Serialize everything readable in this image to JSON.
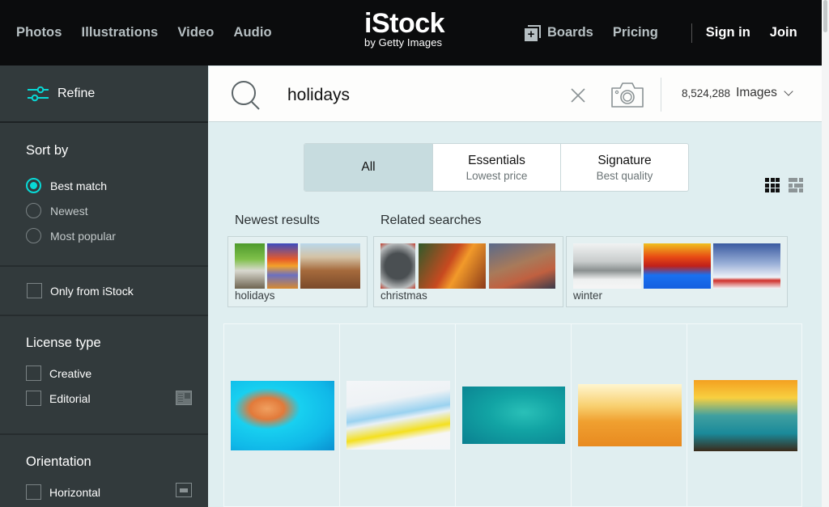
{
  "header": {
    "nav_left": [
      "Photos",
      "Illustrations",
      "Video",
      "Audio"
    ],
    "logo": {
      "main": "iStock",
      "sub": "by Getty Images"
    },
    "boards_label": "Boards",
    "pricing_label": "Pricing",
    "signin_label": "Sign in",
    "join_label": "Join"
  },
  "sidebar": {
    "refine_label": "Refine",
    "sort": {
      "heading": "Sort by",
      "options": [
        {
          "label": "Best match",
          "checked": true
        },
        {
          "label": "Newest",
          "checked": false
        },
        {
          "label": "Most popular",
          "checked": false
        }
      ]
    },
    "only_istock_label": "Only from iStock",
    "license": {
      "heading": "License type",
      "options": [
        "Creative",
        "Editorial"
      ]
    },
    "orientation": {
      "heading": "Orientation",
      "options": [
        "Horizontal"
      ]
    }
  },
  "search": {
    "query": "holidays",
    "result_count": "8,524,288",
    "media_type": "Images"
  },
  "filter_tabs": [
    {
      "title": "All",
      "sub": "",
      "active": true
    },
    {
      "title": "Essentials",
      "sub": "Lowest price",
      "active": false
    },
    {
      "title": "Signature",
      "sub": "Best quality",
      "active": false
    }
  ],
  "sections": {
    "newest": "Newest results",
    "related": "Related searches"
  },
  "cards": [
    {
      "label": "holidays",
      "thumbs": [
        "waterfall",
        "sunset-sky",
        "rooftops"
      ]
    },
    {
      "label": "christmas",
      "thumbs": [
        "holiday-card",
        "christmas-tree-fireplace",
        "family-dinner"
      ]
    },
    {
      "label": "winter",
      "thumbs": [
        "snow-skier",
        "winter-sunset-forest",
        "snowmen"
      ]
    }
  ],
  "results": [
    {
      "subject": "children-swimming-underwater"
    },
    {
      "subject": "vacation-calendar"
    },
    {
      "subject": "aerial-sea-swimmer"
    },
    {
      "subject": "beach-family-sunset"
    },
    {
      "subject": "couple-sunset-boat"
    }
  ],
  "colors": {
    "accent": "#08d9d6",
    "header_bg": "#0b0c0d",
    "sidebar_bg": "#323a3c",
    "main_bg": "#dfeef0"
  }
}
